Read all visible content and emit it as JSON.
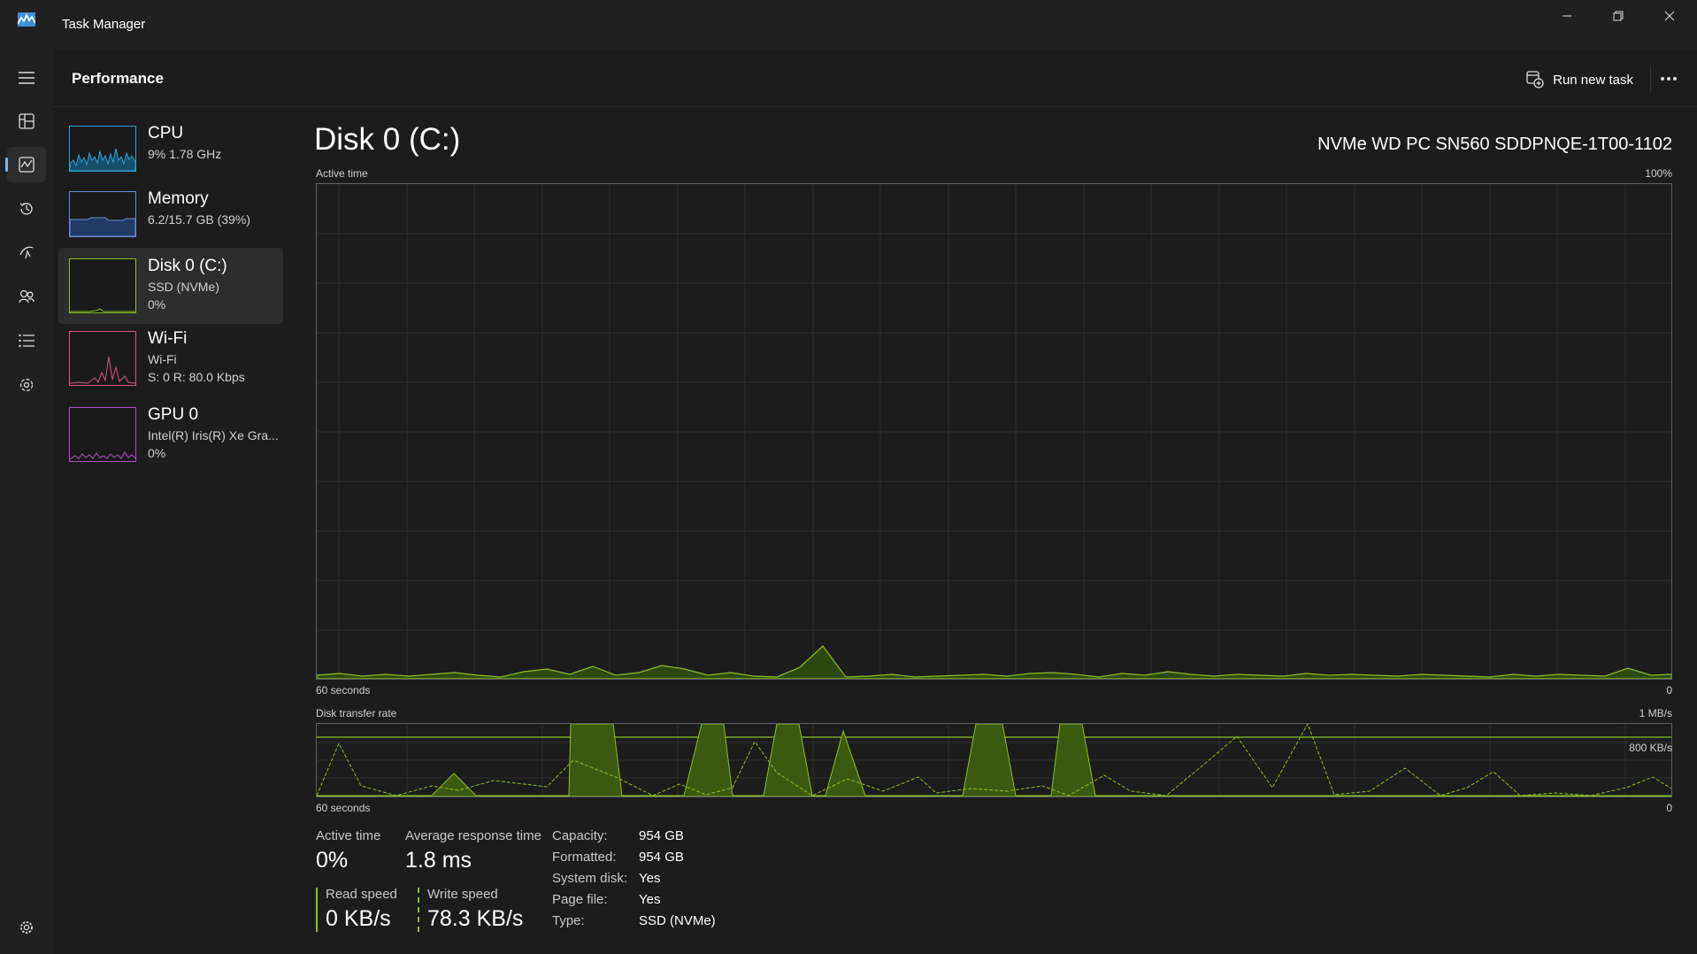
{
  "app": {
    "title": "Task Manager"
  },
  "header": {
    "title": "Performance",
    "run_task_label": "Run new task"
  },
  "devices": [
    {
      "name": "CPU",
      "line1": "9%  1.78 GHz",
      "line2": ""
    },
    {
      "name": "Memory",
      "line1": "6.2/15.7 GB (39%)",
      "line2": ""
    },
    {
      "name": "Disk 0 (C:)",
      "line1": "SSD (NVMe)",
      "line2": "0%"
    },
    {
      "name": "Wi-Fi",
      "line1": "Wi-Fi",
      "line2": "S: 0  R: 80.0 Kbps"
    },
    {
      "name": "GPU 0",
      "line1": "Intel(R) Iris(R) Xe Gra...",
      "line2": "0%"
    }
  ],
  "main": {
    "title": "Disk 0 (C:)",
    "model": "NVMe WD PC SN560 SDDPNQE-1T00-1102",
    "active_graph": {
      "label": "Active time",
      "max": "100%",
      "time_label": "60 seconds",
      "min": "0"
    },
    "transfer_graph": {
      "label": "Disk transfer rate",
      "max": "1 MB/s",
      "line_label": "800 KB/s",
      "time_label": "60 seconds",
      "min": "0"
    }
  },
  "stats": {
    "active_time_label": "Active time",
    "active_time_value": "0%",
    "response_label": "Average response time",
    "response_value": "1.8 ms",
    "read_label": "Read speed",
    "read_value": "0 KB/s",
    "write_label": "Write speed",
    "write_value": "78.3 KB/s"
  },
  "properties": [
    {
      "key": "Capacity:",
      "value": "954 GB"
    },
    {
      "key": "Formatted:",
      "value": "954 GB"
    },
    {
      "key": "System disk:",
      "value": "Yes"
    },
    {
      "key": "Page file:",
      "value": "Yes"
    },
    {
      "key": "Type:",
      "value": "SSD (NVMe)"
    }
  ],
  "colors": {
    "accent": "#76b9ed",
    "disk": "#8cbf26",
    "cpu": "#2ea3d5",
    "memory": "#6a8fd6",
    "wifi": "#d8577a",
    "gpu": "#b04fc4"
  },
  "icons": {
    "menu": "hamburger-icon",
    "processes": "processes-icon",
    "performance": "performance-icon",
    "app_history": "history-icon",
    "startup": "startup-icon",
    "users": "users-icon",
    "details": "details-icon",
    "services": "services-icon",
    "settings": "gear-icon"
  }
}
